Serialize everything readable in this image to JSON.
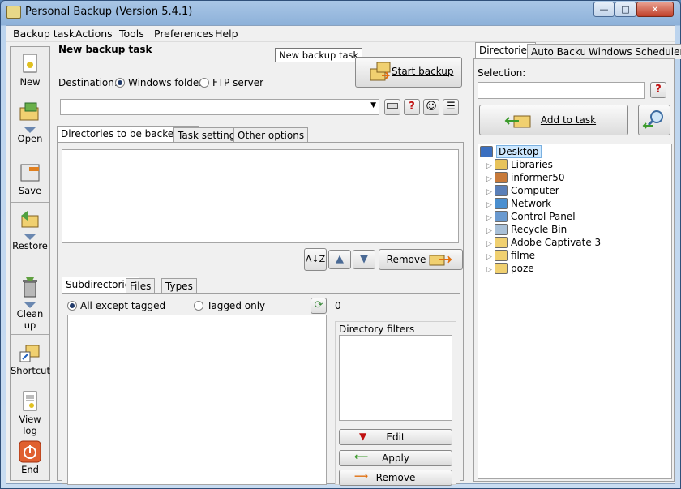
{
  "window": {
    "title": "Personal Backup (Version 5.4.1)",
    "minimize": "—",
    "maximize": "□",
    "close": "✕"
  },
  "menu": [
    "Backup task",
    "Actions",
    "Tools",
    "Preferences",
    "Help"
  ],
  "leftbar": {
    "new": "New",
    "open": "Open",
    "save": "Save",
    "restore": "Restore",
    "cleanup": "Clean up",
    "shortcut": "Shortcut",
    "viewlog": "View log",
    "end": "End"
  },
  "task": {
    "title": "New backup task",
    "tooltip": "New backup task",
    "start_backup": "Start backup",
    "destination_label": "Destination:",
    "dest_windows": "Windows folder",
    "dest_ftp": "FTP server",
    "path_value": ""
  },
  "tabs_main": [
    "Directories to be backed up",
    "Task settings",
    "Other options"
  ],
  "remove_label": "Remove",
  "tabs_sub": [
    "Subdirectories",
    "Files",
    "Types"
  ],
  "subdir": {
    "all_except": "All except tagged",
    "tagged_only": "Tagged only",
    "count": "0",
    "dir_filters": "Directory filters",
    "edit": "Edit",
    "apply": "Apply",
    "remove": "Remove"
  },
  "right": {
    "tabs": [
      "Directories",
      "Auto Backup",
      "Windows Scheduler"
    ],
    "selection_label": "Selection:",
    "selection_value": "",
    "add_to_task": "Add to task",
    "tree": [
      {
        "label": "Desktop",
        "icon": "desktop-icon",
        "color": "#3a6fc0",
        "root": true
      },
      {
        "label": "Libraries",
        "icon": "libraries-icon",
        "color": "#e8c35a"
      },
      {
        "label": "informer50",
        "icon": "user-icon",
        "color": "#c87a3a"
      },
      {
        "label": "Computer",
        "icon": "computer-icon",
        "color": "#5a7fb8"
      },
      {
        "label": "Network",
        "icon": "network-icon",
        "color": "#4a8fd0"
      },
      {
        "label": "Control Panel",
        "icon": "control-panel-icon",
        "color": "#6a9ad0"
      },
      {
        "label": "Recycle Bin",
        "icon": "recycle-bin-icon",
        "color": "#a8c0d8"
      },
      {
        "label": "Adobe Captivate 3",
        "icon": "folder-icon",
        "color": "#f0d070"
      },
      {
        "label": "filme",
        "icon": "folder-icon",
        "color": "#f0d070"
      },
      {
        "label": "poze",
        "icon": "folder-icon",
        "color": "#f0d070"
      }
    ]
  }
}
